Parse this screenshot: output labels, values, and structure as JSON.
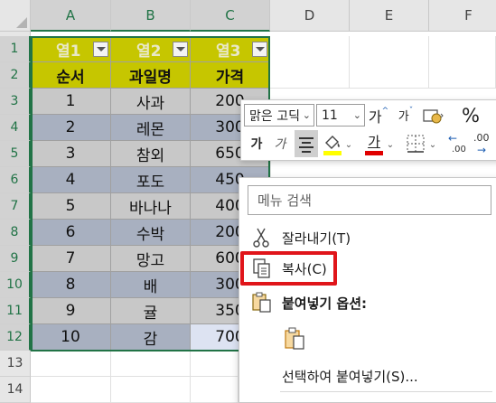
{
  "columns": [
    "A",
    "B",
    "C",
    "D",
    "E",
    "F"
  ],
  "rows": [
    "1",
    "2",
    "3",
    "4",
    "5",
    "6",
    "7",
    "8",
    "9",
    "10",
    "11",
    "12",
    "13",
    "14"
  ],
  "table": {
    "filter_headers": [
      "열1",
      "열2",
      "열3"
    ],
    "headers": [
      "순서",
      "과일명",
      "가격"
    ],
    "data": [
      [
        "1",
        "사과",
        "200"
      ],
      [
        "2",
        "레몬",
        "300"
      ],
      [
        "3",
        "참외",
        "650"
      ],
      [
        "4",
        "포도",
        "450"
      ],
      [
        "5",
        "바나나",
        "400"
      ],
      [
        "6",
        "수박",
        "200"
      ],
      [
        "7",
        "망고",
        "600"
      ],
      [
        "8",
        "배",
        "300"
      ],
      [
        "9",
        "귤",
        "350"
      ],
      [
        "10",
        "감",
        "700"
      ]
    ]
  },
  "mini_toolbar": {
    "font_name": "맑은 고딕",
    "font_size": "11",
    "grow_font": "가",
    "shrink_font": "가",
    "percent": "%",
    "bold": "가",
    "italic": "가",
    "font_color_glyph": "가",
    "dec_left": ".00",
    "dec_right": ".00",
    "colors": {
      "highlight": "#ffff00",
      "font_red": "#e00000"
    }
  },
  "context_menu": {
    "search_placeholder": "메뉴 검색",
    "items": {
      "cut": "잘라내기(T)",
      "copy": "복사(C)",
      "paste_options": "붙여넣기 옵션:",
      "paste_special": "선택하여 붙여넣기(S)..."
    },
    "highlight_color": "#e0151a"
  },
  "theme": {
    "accent": "#217346",
    "header_yellow": "#c6c600",
    "band_light": "#c8c8c8",
    "band_dark": "#a8b0c0"
  }
}
